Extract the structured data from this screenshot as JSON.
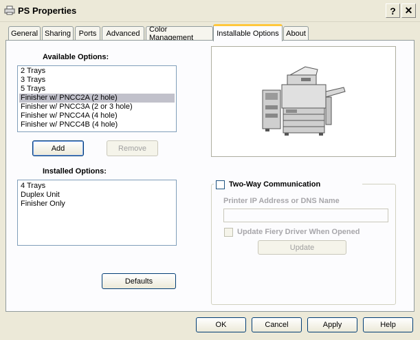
{
  "window": {
    "title": "PS Properties",
    "help_label": "?",
    "close_label": "✕"
  },
  "tabs": [
    {
      "label": "General"
    },
    {
      "label": "Sharing"
    },
    {
      "label": "Ports"
    },
    {
      "label": "Advanced"
    },
    {
      "label": "Color Management"
    },
    {
      "label": "Installable Options"
    },
    {
      "label": "About"
    }
  ],
  "active_tab": "Installable Options",
  "available": {
    "heading": "Available Options:",
    "items": [
      "2 Trays",
      "3 Trays",
      "5 Trays",
      "Finisher w/ PNCC2A (2 hole)",
      "Finisher w/ PNCC3A (2 or 3 hole)",
      "Finisher w/ PNCC4A (4 hole)",
      "Finisher w/ PNCC4B (4 hole)"
    ],
    "selected": "Finisher w/ PNCC2A (2 hole)"
  },
  "buttons": {
    "add": "Add",
    "remove": "Remove",
    "defaults": "Defaults",
    "update": "Update"
  },
  "installed": {
    "heading": "Installed Options:",
    "items": [
      "4 Trays",
      "Duplex Unit",
      "Finisher Only"
    ]
  },
  "two_way": {
    "label": "Two-Way Communication",
    "checked": false,
    "ip_label": "Printer IP Address or DNS Name",
    "ip_value": "",
    "update_fiery_label": "Update Fiery Driver When Opened",
    "update_fiery_checked": false
  },
  "footer": {
    "ok": "OK",
    "cancel": "Cancel",
    "apply": "Apply",
    "help": "Help"
  },
  "colors": {
    "selection": "#c1c1cb",
    "active_tab_accent": "#ffc73c",
    "dialog_bg": "#ece9d8"
  }
}
